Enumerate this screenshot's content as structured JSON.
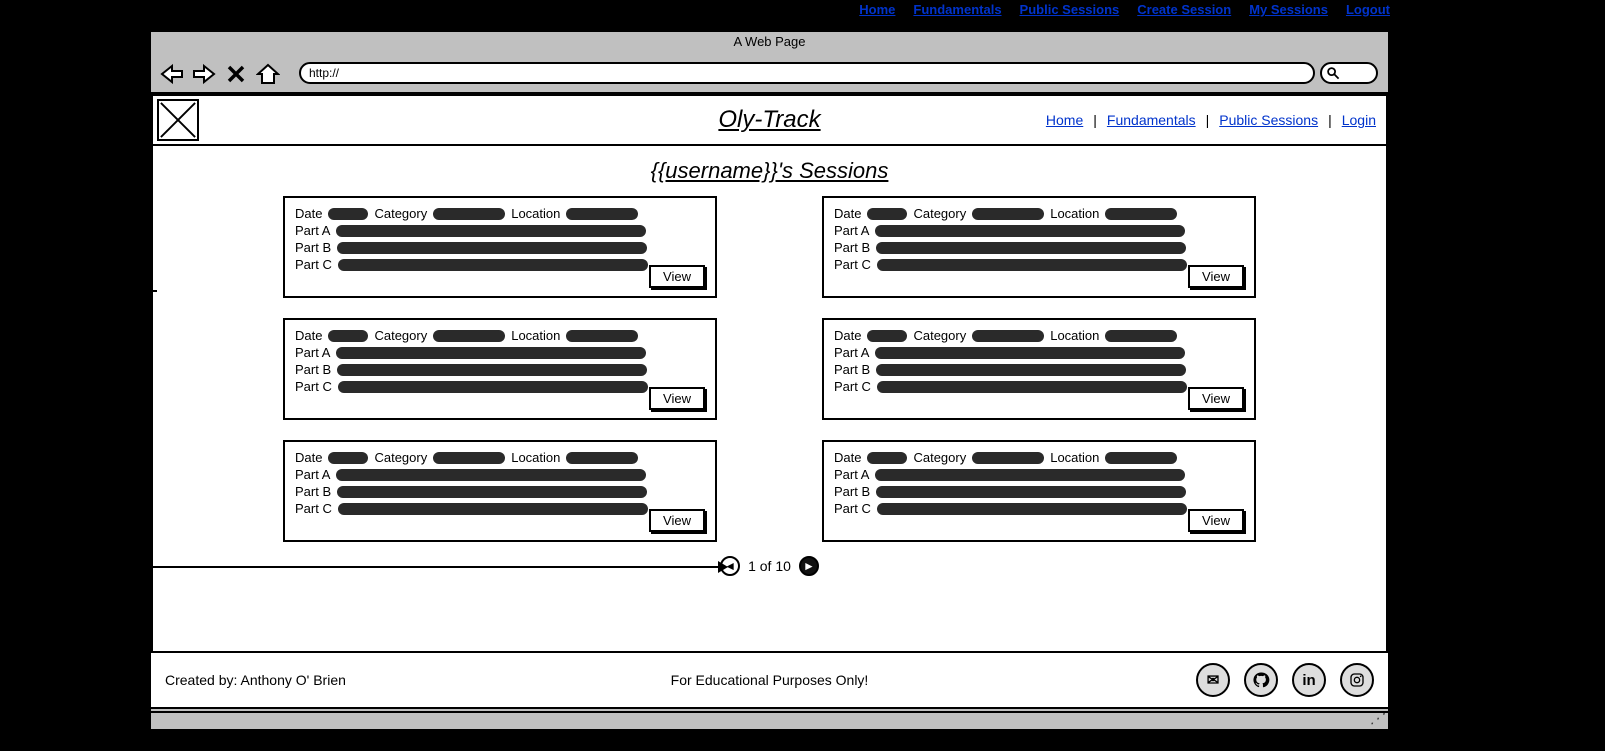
{
  "top_nav": {
    "home": "Home",
    "fundamentals": "Fundamentals",
    "public_sessions": "Public Sessions",
    "create_session": "Create Session",
    "my_sessions": "My Sessions",
    "logout": "Logout"
  },
  "browser": {
    "title": "A Web Page",
    "url": "http://"
  },
  "header": {
    "site_title": "Oly-Track",
    "links": {
      "home": "Home",
      "fundamentals": "Fundamentals",
      "public_sessions": "Public Sessions",
      "login": "Login"
    }
  },
  "page_title": "{{username}}'s Sessions",
  "card_labels": {
    "date": "Date",
    "category": "Category",
    "location": "Location",
    "part_a": "Part A",
    "part_b": "Part B",
    "part_c": "Part C",
    "view": "View"
  },
  "pagination": {
    "text": "1 of 10"
  },
  "footer": {
    "created_by": "Created by: Anthony O' Brien",
    "disclaimer": "For Educational Purposes Only!"
  }
}
